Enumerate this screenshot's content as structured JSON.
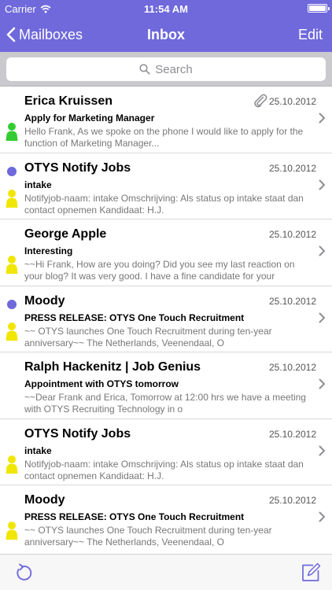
{
  "status_bar": {
    "carrier": "Carrier",
    "time": "11:54 AM"
  },
  "nav": {
    "back_label": "Mailboxes",
    "title": "Inbox",
    "edit_label": "Edit"
  },
  "search": {
    "placeholder": "Search"
  },
  "colors": {
    "accent": "#6f69dc",
    "contact_green": "#33cc33",
    "contact_yellow": "#f0e600"
  },
  "messages": [
    {
      "sender": "Erica Kruissen",
      "date": "25.10.2012",
      "subject": "Apply for Marketing Manager",
      "preview": "Hello Frank, As we spoke on the phone I would like to apply for the function of Marketing Manager...",
      "unread": false,
      "attachment": true,
      "contact_icon": "green-person-icon"
    },
    {
      "sender": "OTYS Notify Jobs",
      "date": "25.10.2012",
      "subject": "intake",
      "preview": "Notifyjob-naam: intake Omschrijving: Als status op intake staat dan contact opnemen Kandidaat: H.J.",
      "unread": true,
      "attachment": false,
      "contact_icon": "yellow-person-icon"
    },
    {
      "sender": "George Apple",
      "date": "25.10.2012",
      "subject": "Interesting",
      "preview": "~~Hi Frank, How are you doing? Did you see my last reaction on your blog? It was very good. I have a fine candidate for your",
      "unread": false,
      "attachment": false,
      "contact_icon": "yellow-person-icon"
    },
    {
      "sender": "Moody",
      "date": "25.10.2012",
      "subject": "PRESS RELEASE: OTYS One Touch Recruitment",
      "preview": "~~ OTYS launches One Touch Recruitment during ten-year anniversary~~ The Netherlands, Veenendaal, O",
      "unread": true,
      "attachment": false,
      "contact_icon": "yellow-person-icon"
    },
    {
      "sender": "Ralph Hackenitz | Job Genius",
      "date": "25.10.2012",
      "subject": "Appointment with OTYS tomorrow",
      "preview": "~~Dear Frank and Erica, Tomorrow at 12:00 hrs we have a meeting with OTYS Recruiting Technology in o",
      "unread": false,
      "attachment": false,
      "contact_icon": "none"
    },
    {
      "sender": "OTYS Notify Jobs",
      "date": "25.10.2012",
      "subject": "intake",
      "preview": "Notifyjob-naam: intake Omschrijving: Als status op intake staat dan contact opnemen Kandidaat: H.J.",
      "unread": false,
      "attachment": false,
      "contact_icon": "yellow-person-icon"
    },
    {
      "sender": "Moody",
      "date": "25.10.2012",
      "subject": "PRESS RELEASE: OTYS One Touch Recruitment",
      "preview": "~~ OTYS launches One Touch Recruitment during ten-year anniversary~~ The Netherlands, Veenendaal, O",
      "unread": false,
      "attachment": false,
      "contact_icon": "yellow-person-icon"
    }
  ],
  "toolbar": {
    "refresh_icon": "refresh-icon",
    "compose_icon": "compose-icon"
  }
}
